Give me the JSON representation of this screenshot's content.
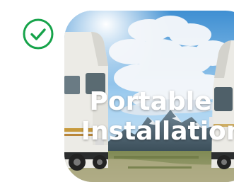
{
  "tile": {
    "selected": true,
    "check_icon": "check-circle-icon",
    "check_color": "#16a34a",
    "title_line1": "Portable",
    "title_line2": "Installation"
  },
  "colors": {
    "sky_top": "#3d8fd1",
    "sky_mid": "#8cc4ec",
    "cloud": "#f4f6f9",
    "mountain": "#4f6470",
    "snow": "#e8edf1",
    "grass": "#8a8f58",
    "rv_body": "#e9e6df",
    "rv_stripe": "#c79a3d"
  }
}
